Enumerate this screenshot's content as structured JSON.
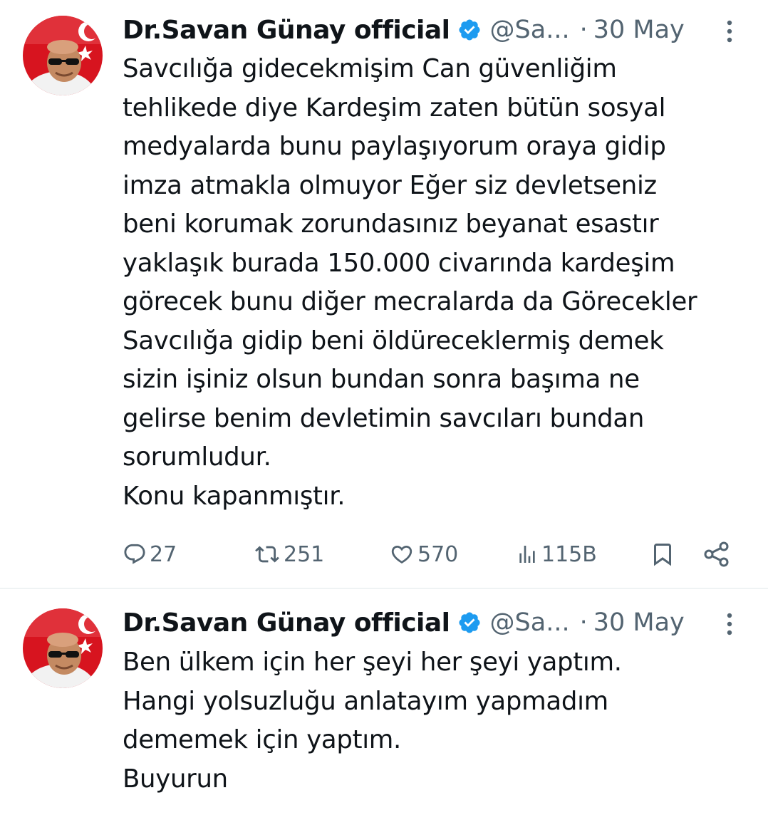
{
  "tweets": [
    {
      "author_name": "Dr.Savan Günay official",
      "handle": "@Sa...",
      "separator": "·",
      "date": "30 May",
      "text_lines": [
        "Savcılığa gidecekmişim Can güvenliğim",
        "tehlikede diye Kardeşim zaten bütün sosyal",
        "medyalarda bunu paylaşıyorum oraya gidip",
        "imza atmakla olmuyor Eğer siz devletseniz",
        "beni korumak zorundasınız beyanat esastır",
        "yaklaşık burada 150.000 civarında kardeşim",
        "görecek bunu diğer mecralarda da Görecekler",
        "Savcılığa gidip beni öldüreceklermiş demek",
        "sizin işiniz olsun bundan sonra başıma ne",
        "gelirse benim devletimin savcıları bundan",
        "sorumludur.",
        "Konu kapanmıştır."
      ],
      "stats": {
        "replies": "27",
        "retweets": "251",
        "likes": "570",
        "views": "115B"
      }
    },
    {
      "author_name": "Dr.Savan Günay official",
      "handle": "@Sa...",
      "separator": "·",
      "date": "30 May",
      "text_lines": [
        "Ben ülkem için her şeyi her şeyi yaptım.",
        "Hangi yolsuzluğu anlatayım yapmadım",
        "dememek için yaptım.",
        "Buyurun"
      ]
    }
  ],
  "icons": {
    "verified": "verified-badge-icon",
    "more": "more-vertical-icon",
    "reply": "reply-icon",
    "retweet": "retweet-icon",
    "like": "heart-icon",
    "views": "views-icon",
    "bookmark": "bookmark-icon",
    "share": "share-icon"
  },
  "colors": {
    "verified_blue": "#1d9bf0",
    "text": "#0f1419",
    "secondary": "#536471",
    "divider": "#eff3f4"
  }
}
